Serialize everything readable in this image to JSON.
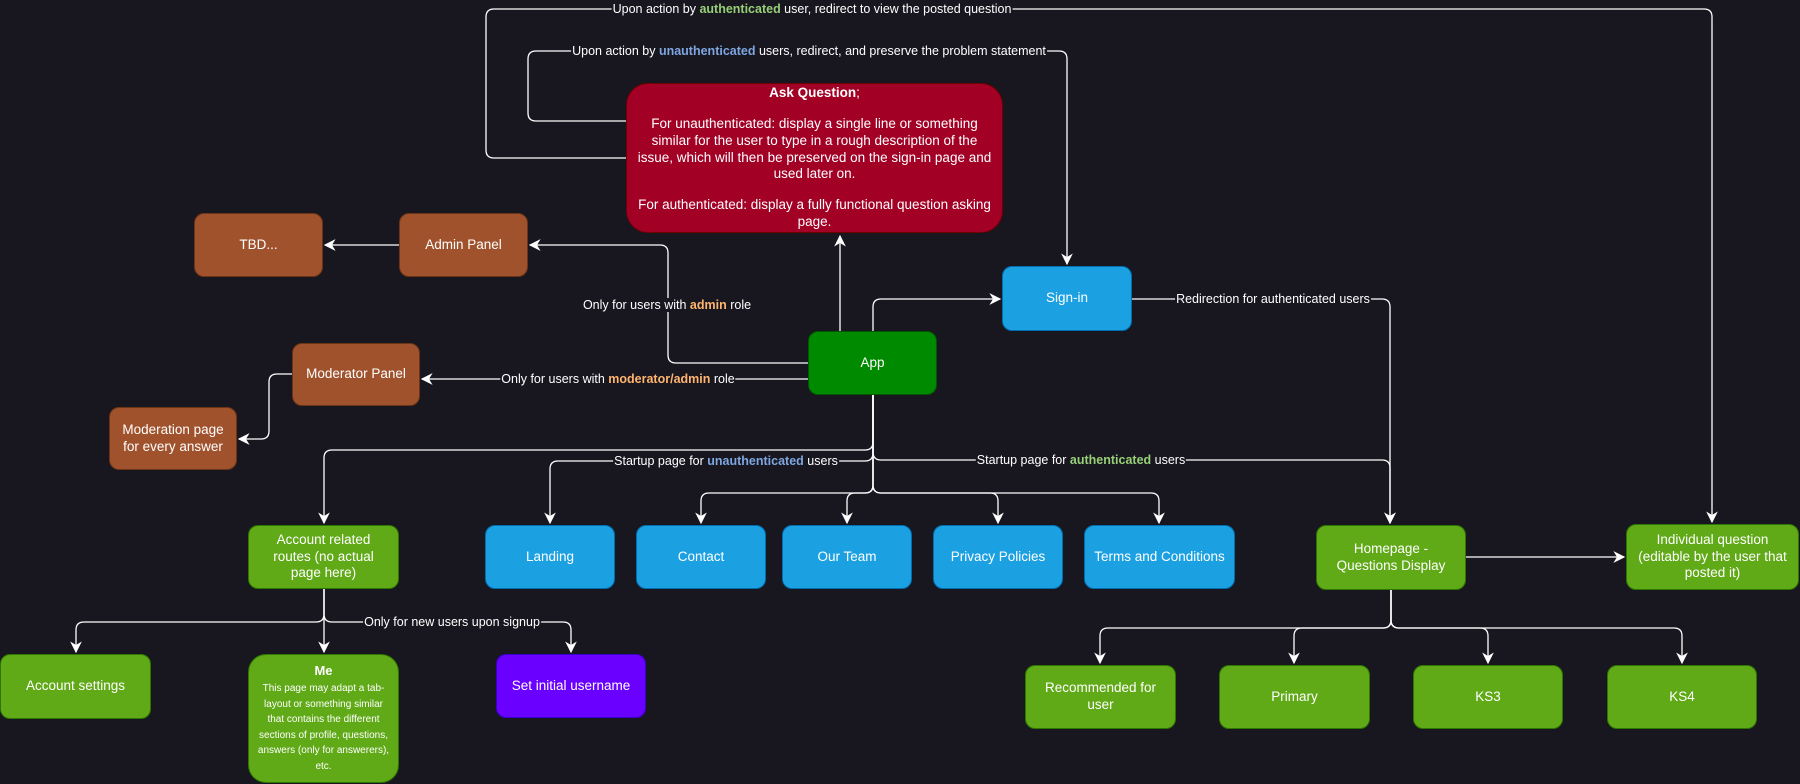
{
  "colors": {
    "background": "#18161f",
    "edge": "#ffffff",
    "authenticated_highlight": "#97d077",
    "unauthenticated_highlight": "#7ea6e0",
    "role_highlight": "#ffb570"
  },
  "nodes": {
    "ask_question": {
      "title": "Ask Question",
      "title_suffix": ";",
      "para1": "For unauthenticated: display a single line or something similar for the user to type in a rough description of the issue, which will then be preserved on the sign-in  page and used later on.",
      "para2": "For authenticated: display a fully functional question asking page."
    },
    "tbd": "TBD...",
    "admin_panel": "Admin Panel",
    "moderator_panel": "Moderator Panel",
    "moderation_page": "Moderation page for every answer",
    "app": "App",
    "sign_in": "Sign-in",
    "account_routes": "Account related routes (no actual page here)",
    "landing": "Landing",
    "contact": "Contact",
    "our_team": "Our Team",
    "privacy": "Privacy Policies",
    "terms": "Terms and Conditions",
    "homepage": "Homepage - Questions Display",
    "individual_question": "Individual question (editable by the user that posted it)",
    "account_settings": "Account settings",
    "me": {
      "title": "Me",
      "body": "This page may adapt a tab-layout or something similar that contains the different sections of profile, questions, answers (only for answerers), etc."
    },
    "set_username": "Set initial username",
    "recommended": "Recommended for user",
    "primary": "Primary",
    "ks3": "KS3",
    "ks4": "KS4"
  },
  "edge_labels": {
    "auth_redirect": {
      "pre": "Upon action by ",
      "hl": "authenticated",
      "post": " user, redirect to view the posted question"
    },
    "unauth_redirect": {
      "pre": "Upon action by ",
      "hl": "unauthenticated",
      "post": " users, redirect, and preserve the problem statement"
    },
    "admin_only": {
      "pre": "Only for users with ",
      "hl": "admin",
      "post": " role"
    },
    "moderator_only": {
      "pre": "Only for users with ",
      "hl": "moderator/admin",
      "post": " role"
    },
    "signin_redirect": "Redirection for authenticated users",
    "startup_unauth": {
      "pre": "Startup page for ",
      "hl": "unauthenticated",
      "post": " users"
    },
    "startup_auth": {
      "pre": "Startup page for ",
      "hl": "authenticated",
      "post": " users"
    },
    "new_users": "Only for new users upon signup"
  }
}
